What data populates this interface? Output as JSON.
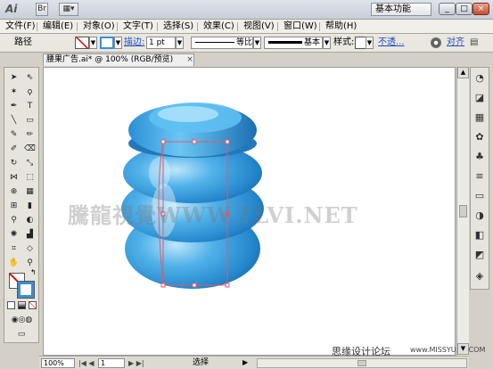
{
  "window": {
    "workspace_label": "基本功能",
    "min_label": "_",
    "restore_label": "□",
    "close_label": "×"
  },
  "menubar": {
    "items": [
      "文件(F)",
      "编辑(E)",
      "对象(O)",
      "文字(T)",
      "选择(S)",
      "效果(C)",
      "视图(V)",
      "窗口(W)",
      "帮助(H)"
    ]
  },
  "control_bar": {
    "selection_label": "路径",
    "stroke_label": "描边:",
    "stroke_weight": "1 pt",
    "uniform_label": "等比",
    "brush_label": "基本",
    "style_label": "样式:",
    "opacity_link": "不透...",
    "align_link": "对齐"
  },
  "document": {
    "tab_title": "腰果广告.ai* @ 100% (RGB/预览)",
    "zoom": "100%",
    "page": "1",
    "status_text": "选择",
    "watermark": "騰龍視覺WWW.TLVI.NET",
    "credit": "思缘设计论坛",
    "credit_site": "www.MISSYUAN.COM"
  },
  "colors": {
    "jar_main": "#3a9fdc",
    "jar_dark": "#1a6fb0",
    "selection": "#e05a6a"
  }
}
